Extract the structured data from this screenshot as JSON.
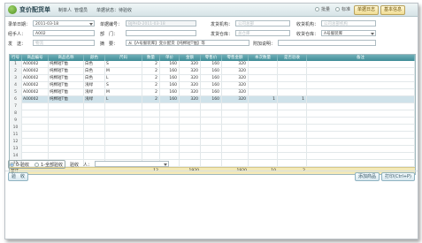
{
  "header": {
    "title": "变价配货单",
    "maker_label": "制单人",
    "maker_value": "管理员",
    "status_label": "单据状态：",
    "status_value": "待验收",
    "radio_options": [
      "批量",
      "标准",
      "明细"
    ],
    "radio_selected": 2,
    "btn_print_preview": "单据日志",
    "btn_basic_info": "基本信息"
  },
  "form": {
    "date_label": "录单日期：",
    "date_value": "2011-03-18",
    "billno_label": "单据编号：",
    "billno_value": "BJPHD-2011-03-18",
    "send_org_label": "发货机构：",
    "send_org_value": "公司总部",
    "recv_org_label": "收货机构：",
    "recv_org_value": "公司总部机构",
    "handler_label": "经手人：",
    "handler_value": "A002",
    "dept_label": "部　门：",
    "dept_value": "",
    "send_wh_label": "发货仓库：",
    "send_wh_value": "总仓库",
    "recv_wh_label": "收货仓库：",
    "recv_wh_value": "A号服装库",
    "shipper_label": "发　送：",
    "shipper_value": "物流",
    "summary_label": "摘　要：",
    "summary_value": "从【A号服装库】变价配货【纯棉短T恤】等",
    "extra_label": "附加说明："
  },
  "grid": {
    "columns": [
      "行号",
      "商品编号",
      "商品名称",
      "颜色",
      "尺码",
      "数量",
      "单价",
      "金额",
      "零售价",
      "零售金额",
      "本次数量",
      "是否验收",
      "备注"
    ],
    "rows": [
      [
        "1",
        "A00002",
        "纯棉短T恤",
        "白色",
        "S",
        "2",
        "160",
        "320",
        "160",
        "320",
        "",
        "",
        ""
      ],
      [
        "2",
        "A00002",
        "纯棉短T恤",
        "白色",
        "M",
        "2",
        "160",
        "320",
        "160",
        "320",
        "",
        "",
        ""
      ],
      [
        "3",
        "A00002",
        "纯棉短T恤",
        "白色",
        "L",
        "2",
        "160",
        "320",
        "160",
        "320",
        "",
        "",
        ""
      ],
      [
        "4",
        "A00002",
        "纯棉短T恤",
        "浅绿",
        "S",
        "2",
        "160",
        "320",
        "160",
        "320",
        "",
        "",
        ""
      ],
      [
        "5",
        "A00002",
        "纯棉短T恤",
        "浅绿",
        "M",
        "2",
        "160",
        "320",
        "160",
        "320",
        "",
        "",
        ""
      ],
      [
        "6",
        "A00002",
        "纯棉短T恤",
        "浅绿",
        "L",
        "2",
        "160",
        "320",
        "160",
        "320",
        "1",
        "1",
        ""
      ]
    ],
    "empty_row_numbers": [
      "7",
      "8",
      "9",
      "10",
      "11",
      "12",
      "13",
      "14",
      "15"
    ],
    "selected_row": 5,
    "summary": {
      "label": "合计",
      "qty": "12",
      "amount": "1920",
      "retail_amount": "1920",
      "this_qty": "10",
      "accepted": "2"
    }
  },
  "bottom": {
    "accept_options": [
      "0-验收",
      "1-全部验收"
    ],
    "accept_selected": 0,
    "acceptor_label": "验收　人：",
    "acceptor_value": "",
    "btn_left": "验　收",
    "btn_add": "添加商品",
    "btn_print": "打印(Ctrl+P)"
  },
  "colors": {
    "grid_header": "#4f9aa3",
    "selected_row": "#cfe2ea",
    "summary_row": "#f3e9b8",
    "accent_button": "#f0dc92"
  }
}
